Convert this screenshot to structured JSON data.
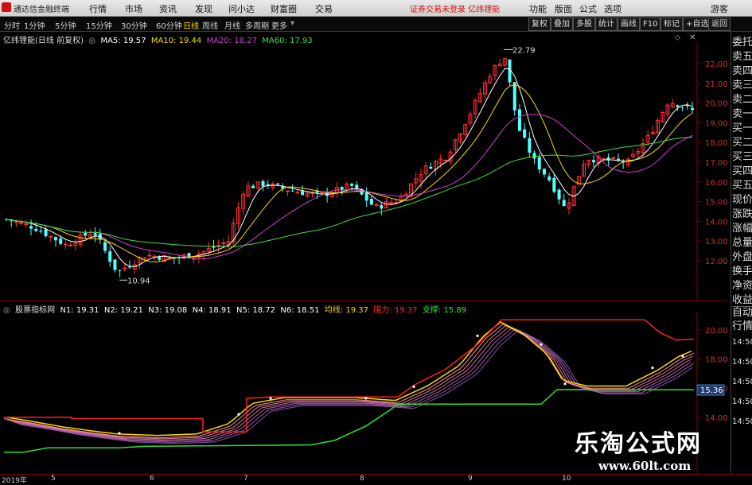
{
  "titlebar": {
    "app_name": "通达信金融终端",
    "notice": "证券交易未登录  亿纬锂能"
  },
  "menu": [
    "行情",
    "市场",
    "资讯",
    "发现",
    "问小达",
    "财富圈",
    "交易"
  ],
  "menu_right": [
    "功能",
    "版面",
    "公式",
    "选项",
    "游客"
  ],
  "toolbar": {
    "periods": [
      "分时",
      "1分钟",
      "5分钟",
      "15分钟",
      "30分钟",
      "60分钟",
      "日线",
      "周线",
      "月线",
      "多周期",
      "更多"
    ],
    "active_period": "日线",
    "right_buttons": [
      "复权",
      "叠加",
      "多股",
      "统计",
      "画线",
      "F10",
      "标记",
      "+自选",
      "返回"
    ]
  },
  "main_chart": {
    "title": "亿纬锂能(日线 前复权)",
    "ma_labels": [
      {
        "text": "MA5: 19.57",
        "color": "#ffffff"
      },
      {
        "text": "MA10: 19.44",
        "color": "#ffd800"
      },
      {
        "text": "MA20: 18.27",
        "color": "#d040d0"
      },
      {
        "text": "MA60: 17.93",
        "color": "#40e040"
      }
    ],
    "high_label": "22.79",
    "low_label": "10.94",
    "y_ticks": [
      "22.00",
      "21.00",
      "20.00",
      "19.00",
      "18.00",
      "17.00",
      "16.00",
      "15.00",
      "14.00",
      "13.00",
      "12.00"
    ]
  },
  "indicator": {
    "title": "股票指标网",
    "labels": [
      {
        "text": "N1: 19.31",
        "color": "#ffffff"
      },
      {
        "text": "N2: 19.21",
        "color": "#ffffff"
      },
      {
        "text": "N3: 19.08",
        "color": "#ffffff"
      },
      {
        "text": "N4: 18.91",
        "color": "#ffffff"
      },
      {
        "text": "N5: 18.72",
        "color": "#ffffff"
      },
      {
        "text": "N6: 18.51",
        "color": "#ffffff"
      },
      {
        "text": "均线: 19.37",
        "color": "#ffd800"
      },
      {
        "text": "阻力: 19.37",
        "color": "#ff3030"
      },
      {
        "text": "支撑: 15.89",
        "color": "#30e030"
      }
    ],
    "y_ticks": [
      "20.00",
      "18.00",
      "16.00",
      "14.00"
    ],
    "current_value": "15.36"
  },
  "right_panel": [
    "委托",
    "卖五",
    "卖四",
    "卖三",
    "卖二",
    "卖一",
    "买一",
    "买二",
    "买三",
    "买四",
    "买五",
    "现价",
    "涨跌",
    "涨幅",
    "总量",
    "外盘",
    "换手",
    "净资",
    "收益",
    "自动",
    "行情"
  ],
  "right_side_ticks": [
    "14:50",
    "14:50",
    "14:50",
    "14:50",
    "14:50"
  ],
  "time_axis": [
    "2019年",
    "5",
    "6",
    "7",
    "8",
    "9",
    "10"
  ],
  "watermark": {
    "title": "乐淘公式网",
    "url": "www.60lt.com"
  },
  "colors": {
    "up": "#ff3232",
    "down": "#54ffff",
    "ma5": "#ffffff",
    "ma10": "#ffd800",
    "ma20": "#d040d0",
    "ma60": "#40e040"
  }
}
